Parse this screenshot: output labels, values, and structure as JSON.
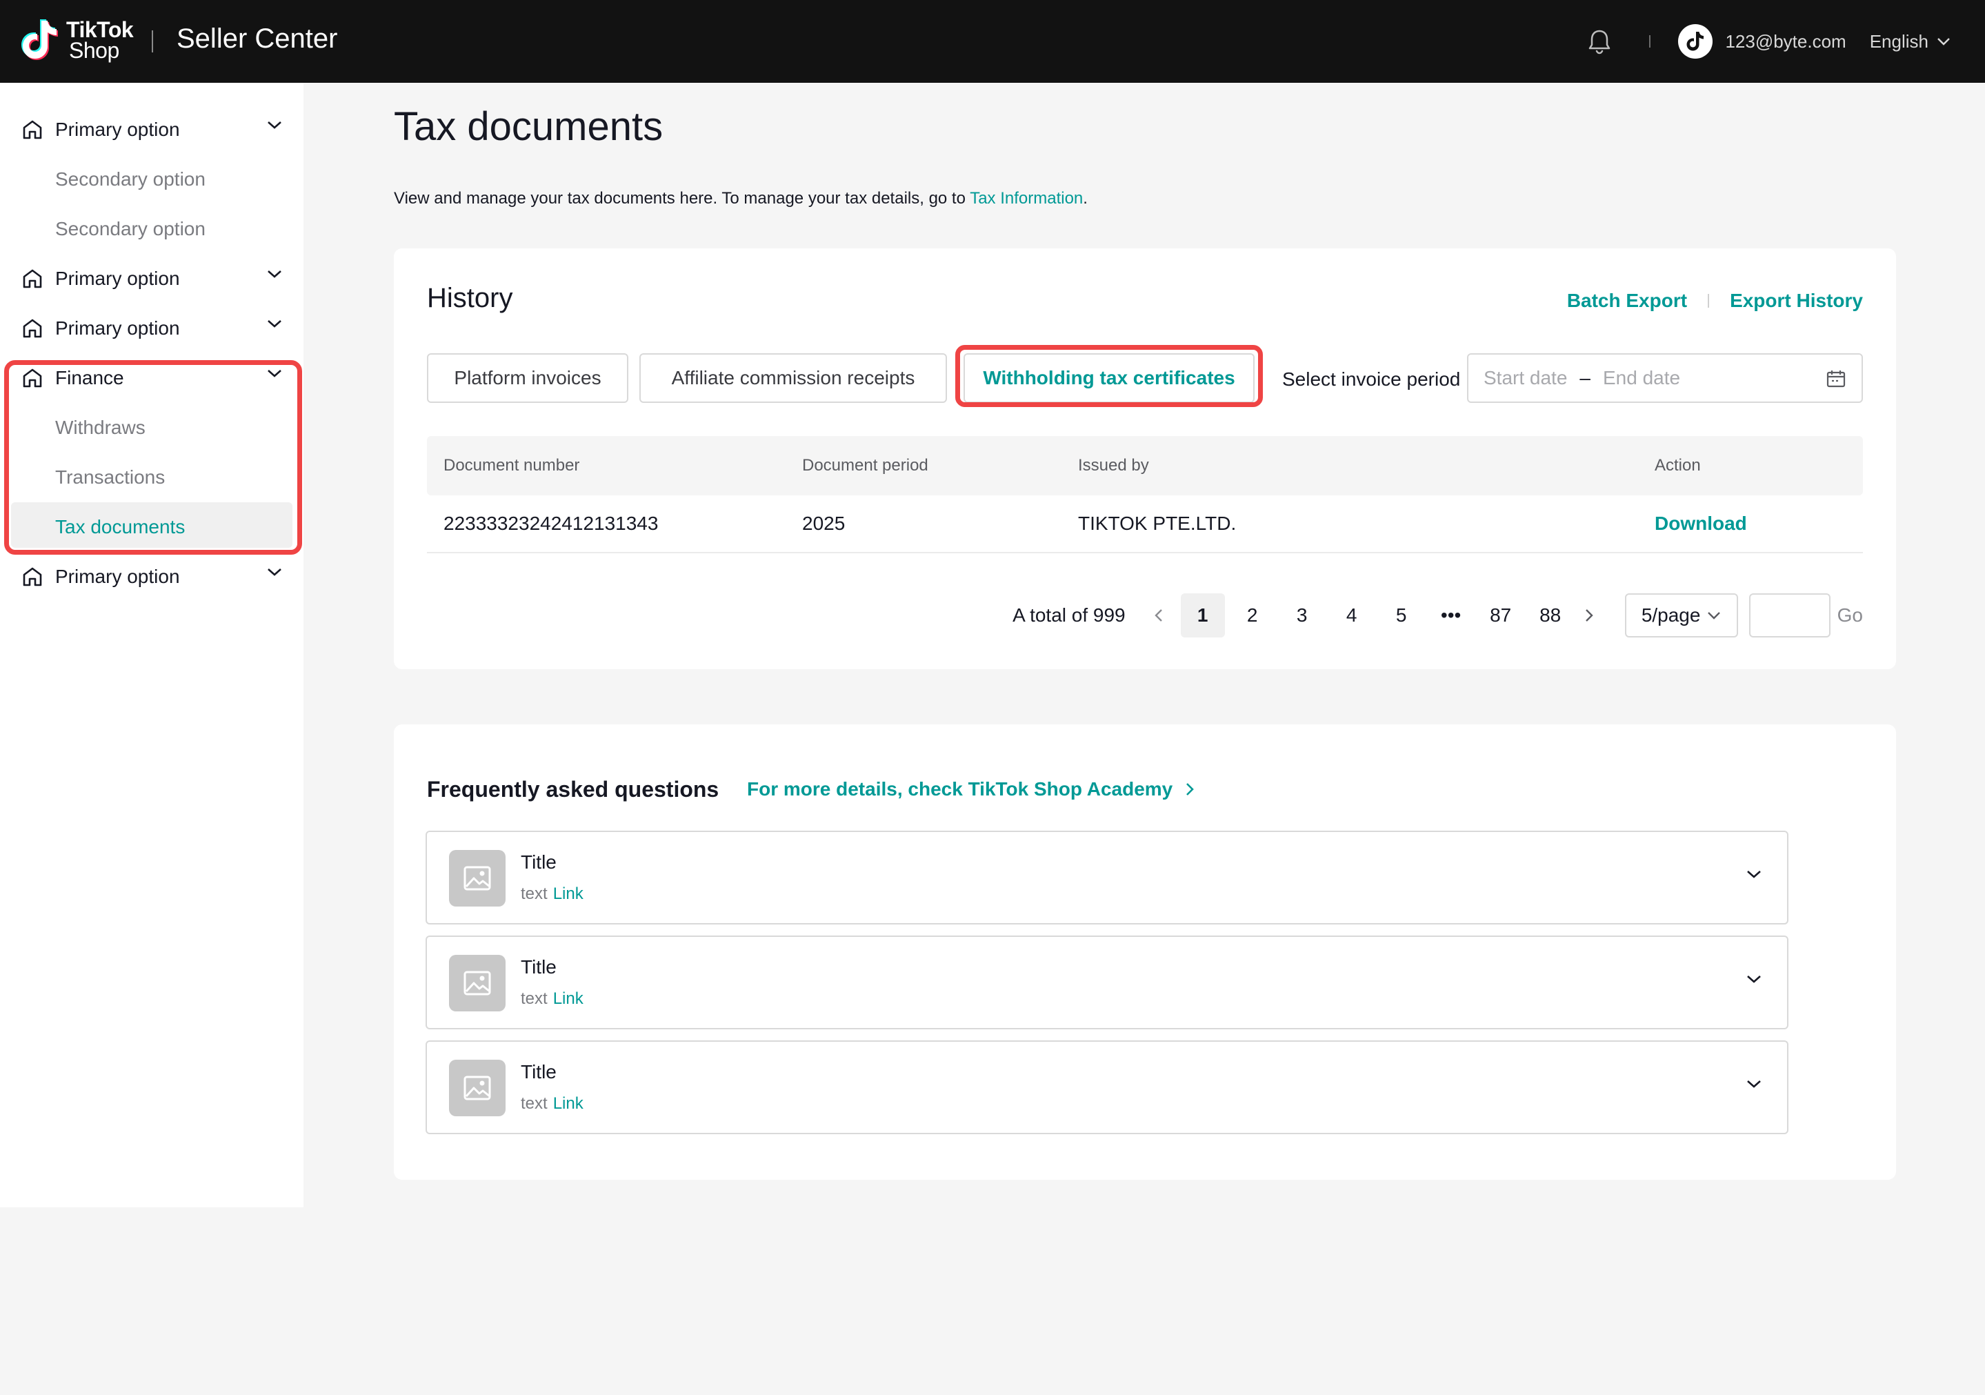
{
  "header": {
    "logo_main": "TikTok",
    "logo_sub": "Shop",
    "product": "Seller Center",
    "email": "123@byte.com",
    "language": "English"
  },
  "sidebar": {
    "items": [
      {
        "label": "Primary option"
      },
      {
        "label": "Secondary option"
      },
      {
        "label": "Secondary option"
      },
      {
        "label": "Primary option"
      },
      {
        "label": "Primary option"
      },
      {
        "label": "Finance"
      },
      {
        "label": "Withdraws"
      },
      {
        "label": "Transactions"
      },
      {
        "label": "Tax documents"
      },
      {
        "label": "Primary option"
      }
    ]
  },
  "page": {
    "title": "Tax documents",
    "desc_prefix": "View and manage your tax documents here. To manage your tax details, go to ",
    "desc_link": "Tax Information",
    "desc_suffix": "."
  },
  "history": {
    "title": "History",
    "batch_export": "Batch Export",
    "export_history": "Export History",
    "tabs": [
      {
        "label": "Platform invoices"
      },
      {
        "label": "Affiliate commission receipts"
      },
      {
        "label": "Withholding tax certificates"
      }
    ],
    "period_label": "Select invoice period",
    "start_placeholder": "Start date",
    "end_placeholder": "End date",
    "columns": [
      "Document number",
      "Document period",
      "Issued by",
      "Action"
    ],
    "rows": [
      {
        "number": "22333323242412131343",
        "period": "2025",
        "issuer": "TIKTOK PTE.LTD.",
        "action": "Download"
      }
    ],
    "pagination": {
      "total": "A total of 999",
      "pages": [
        "1",
        "2",
        "3",
        "4",
        "5",
        "•••",
        "87",
        "88"
      ],
      "page_size": "5/page",
      "go": "Go"
    }
  },
  "faq": {
    "title": "Frequently asked questions",
    "more_link": "For more details, check TikTok Shop Academy",
    "items": [
      {
        "title": "Title",
        "text": "text",
        "link": "Link"
      },
      {
        "title": "Title",
        "text": "text",
        "link": "Link"
      },
      {
        "title": "Title",
        "text": "text",
        "link": "Link"
      }
    ]
  },
  "colors": {
    "accent": "#009995",
    "highlight": "#ef4444",
    "topbar": "#121212"
  }
}
